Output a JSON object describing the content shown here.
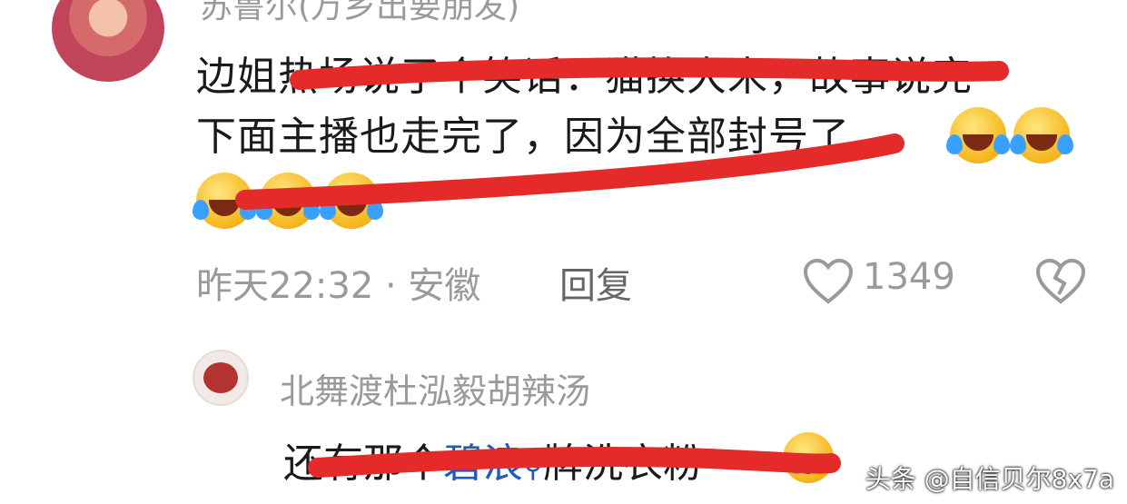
{
  "comment": {
    "username": "苏鲁尔(万乡出要朋发)",
    "lines": [
      "边姐热场说了个笑话：猫换大米，故事说完",
      "下面主播也走完了，因为全部封号了"
    ],
    "meta": {
      "time_location": "昨天22:32 · 安徽",
      "reply_label": "回复",
      "like_count": "1349"
    }
  },
  "reply": {
    "username": "北舞渡杜泓毅胡辣汤",
    "text_before": "还有那个",
    "link_text": "碧浪",
    "text_after": "牌洗衣粉"
  },
  "watermark": "头条 @自信贝尔8x7a",
  "icons": [
    "avatar",
    "laughing-tears-emoji",
    "heart-icon",
    "broken-heart-icon",
    "search-icon",
    "crying-emoji"
  ],
  "colors": {
    "scribble": "#e52a2a",
    "link": "#1f5bbf",
    "meta": "#9a9a9a"
  }
}
